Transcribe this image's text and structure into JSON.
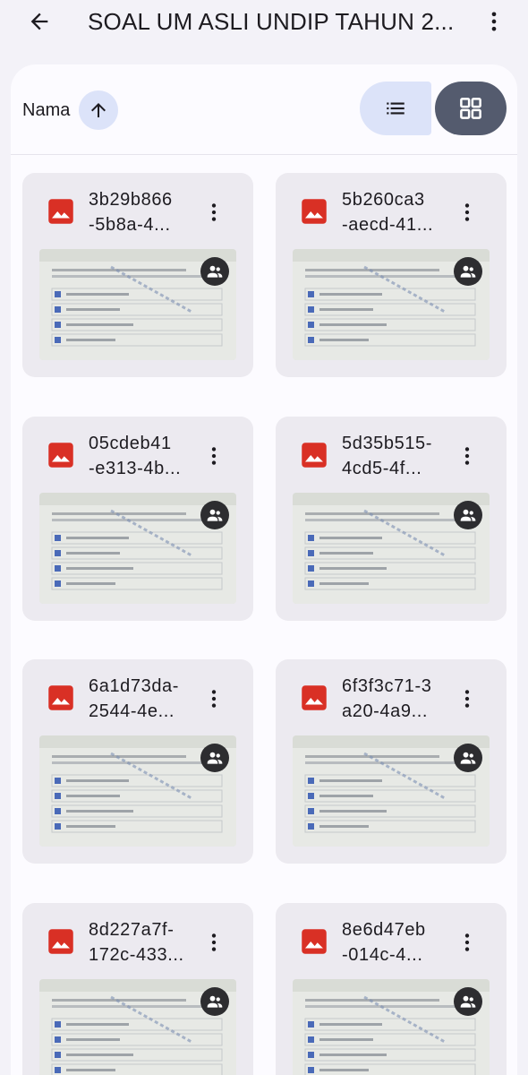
{
  "header": {
    "title": "SOAL UM ASLI UNDIP TAHUN 2...",
    "back_icon": "arrow-left-icon",
    "more_icon": "more-vert-icon"
  },
  "sortbar": {
    "sort_label": "Nama",
    "sort_icon": "arrow-up-icon",
    "list_view_icon": "list-view-icon",
    "grid_view_icon": "grid-view-icon",
    "active_view": "grid"
  },
  "files": [
    {
      "name": "3b29b866-5b8a-4...",
      "line1": "3b29b866",
      "line2": "-5b8a-4...",
      "type": "image",
      "shared": true
    },
    {
      "name": "5b260ca3-aecd-41...",
      "line1": "5b260ca3",
      "line2": "-aecd-41...",
      "type": "image",
      "shared": true
    },
    {
      "name": "05cdeb41-e313-4b...",
      "line1": "05cdeb41",
      "line2": "-e313-4b...",
      "type": "image",
      "shared": true
    },
    {
      "name": "5d35b515-4cd5-4f...",
      "line1": "5d35b515-",
      "line2": "4cd5-4f...",
      "type": "image",
      "shared": true
    },
    {
      "name": "6a1d73da-2544-4e...",
      "line1": "6a1d73da-",
      "line2": "2544-4e...",
      "type": "image",
      "shared": true
    },
    {
      "name": "6f3f3c71-3a20-4a9...",
      "line1": "6f3f3c71-3",
      "line2": "a20-4a9...",
      "type": "image",
      "shared": true
    },
    {
      "name": "8d227a7f-172c-433...",
      "line1": "8d227a7f-",
      "line2": "172c-433...",
      "type": "image",
      "shared": true
    },
    {
      "name": "8e6d47eb-014c-4...",
      "line1": "8e6d47eb",
      "line2": "-014c-4...",
      "type": "image",
      "shared": true
    }
  ],
  "colors": {
    "background": "#f3f2f8",
    "panel": "#fcfbff",
    "card": "#eceaf0",
    "sort_button": "#dce3f9",
    "grid_button_active": "#545b6e",
    "image_icon": "#d93025",
    "shared_badge": "#2d2d30"
  }
}
